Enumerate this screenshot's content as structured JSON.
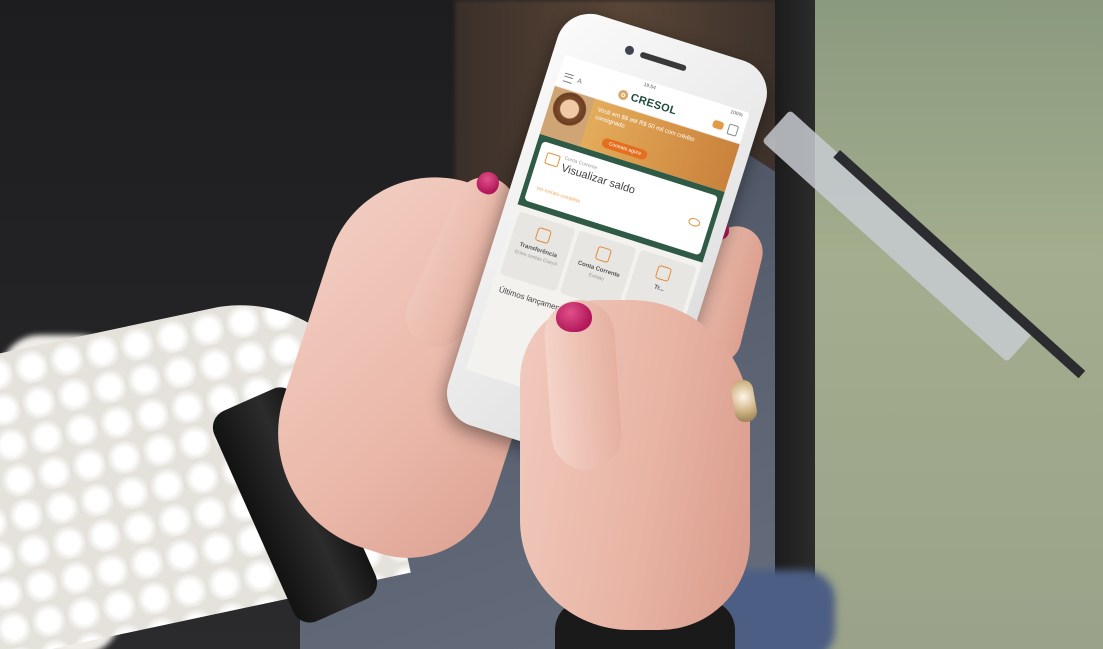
{
  "status_bar": {
    "carrier": "",
    "time": "19:54",
    "battery": "100%"
  },
  "header": {
    "font_control": "A",
    "logo_text": "CRESOL",
    "logo_mark": "✿"
  },
  "banner": {
    "text": "Você em $$ até R$ 50 mil com crédito consignado",
    "button": "Contrate agora"
  },
  "balance_card": {
    "label": "Conta Corrente",
    "title": "Visualizar saldo",
    "subtitle": "Ver extrato completo"
  },
  "shortcuts": [
    {
      "label": "Transferência",
      "sublabel": "Entre contas Cresol",
      "icon": "transfer-icon"
    },
    {
      "label": "Conta Corrente",
      "sublabel": "Extrato",
      "icon": "wallet-icon"
    },
    {
      "label": "Tr...",
      "sublabel": "",
      "icon": "more-icon"
    }
  ],
  "section": {
    "title": "Últimos lançamentos"
  },
  "colors": {
    "brand_green": "#2f5a45",
    "accent_orange": "#e0943e",
    "nail_pink": "#c4286a"
  }
}
